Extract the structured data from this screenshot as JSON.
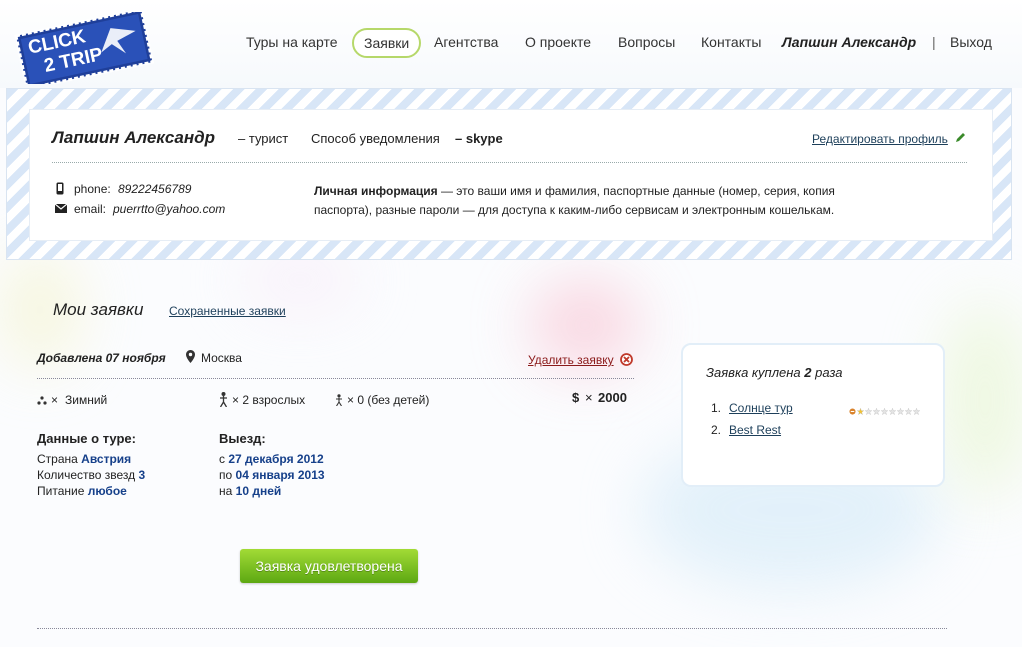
{
  "logo": {
    "line1": "CLICK",
    "line2": "2 TRIP"
  },
  "nav": {
    "items": [
      "Туры на карте",
      "Заявки",
      "Агентства",
      "О проекте",
      "Вопросы",
      "Контакты"
    ],
    "active_index": 1,
    "user_name": "Лапшин Александр",
    "separator": "|",
    "logout": "Выход"
  },
  "profile": {
    "name": "Лапшин Александр",
    "role": "– турист",
    "notify_label": "Способ уведомления",
    "notify_value": "– skype",
    "edit_link": "Редактировать профиль",
    "phone_label": "phone:",
    "phone_value": "89222456789",
    "email_label": "email:",
    "email_value": "puerrtto@yahoo.com",
    "info_title": "Личная информация",
    "info_line1": " — это ваши имя и фамилия, паспортные данные (номер, серия, копия",
    "info_line2": "паспорта), разные пароли — для доступа к каким-либо сервисам и электронным кошелькам."
  },
  "requests": {
    "title": "Мои заявки",
    "saved_link": "Сохраненные заявки",
    "added": "Добавлена 07 ноября",
    "city": "Москва",
    "delete_link": "Удалить заявку",
    "season_prefix": "×",
    "season": "Зимний",
    "adults": "× 2 взрослых",
    "children": "× 0 (без детей)",
    "price_symbol": "$",
    "price_mult": "×",
    "price": "2000",
    "tour_header": "Данные о туре:",
    "country_label": "Страна",
    "country_value": "Австрия",
    "stars_label": "Количество звезд",
    "stars_value": "3",
    "food_label": "Питание",
    "food_value": "любое",
    "depart_header": "Выезд:",
    "from_label": "с",
    "from_value": "27 декабря 2012",
    "to_label": "по",
    "to_value": "04 января 2013",
    "dur_label": "на",
    "dur_value": "10 дней",
    "status_button": "Заявка удовлетворена"
  },
  "side": {
    "title_before": "Заявка куплена",
    "count": "2",
    "title_after": "раза",
    "agencies": [
      {
        "num": "1.",
        "name": "Солнце тур"
      },
      {
        "num": "2.",
        "name": "Best Rest"
      }
    ],
    "rating_stars": 8,
    "rating_filled": 1
  },
  "colors": {
    "accent_green": "#7cc225",
    "link_blue": "#16408a",
    "delete_red": "#c0392b"
  }
}
